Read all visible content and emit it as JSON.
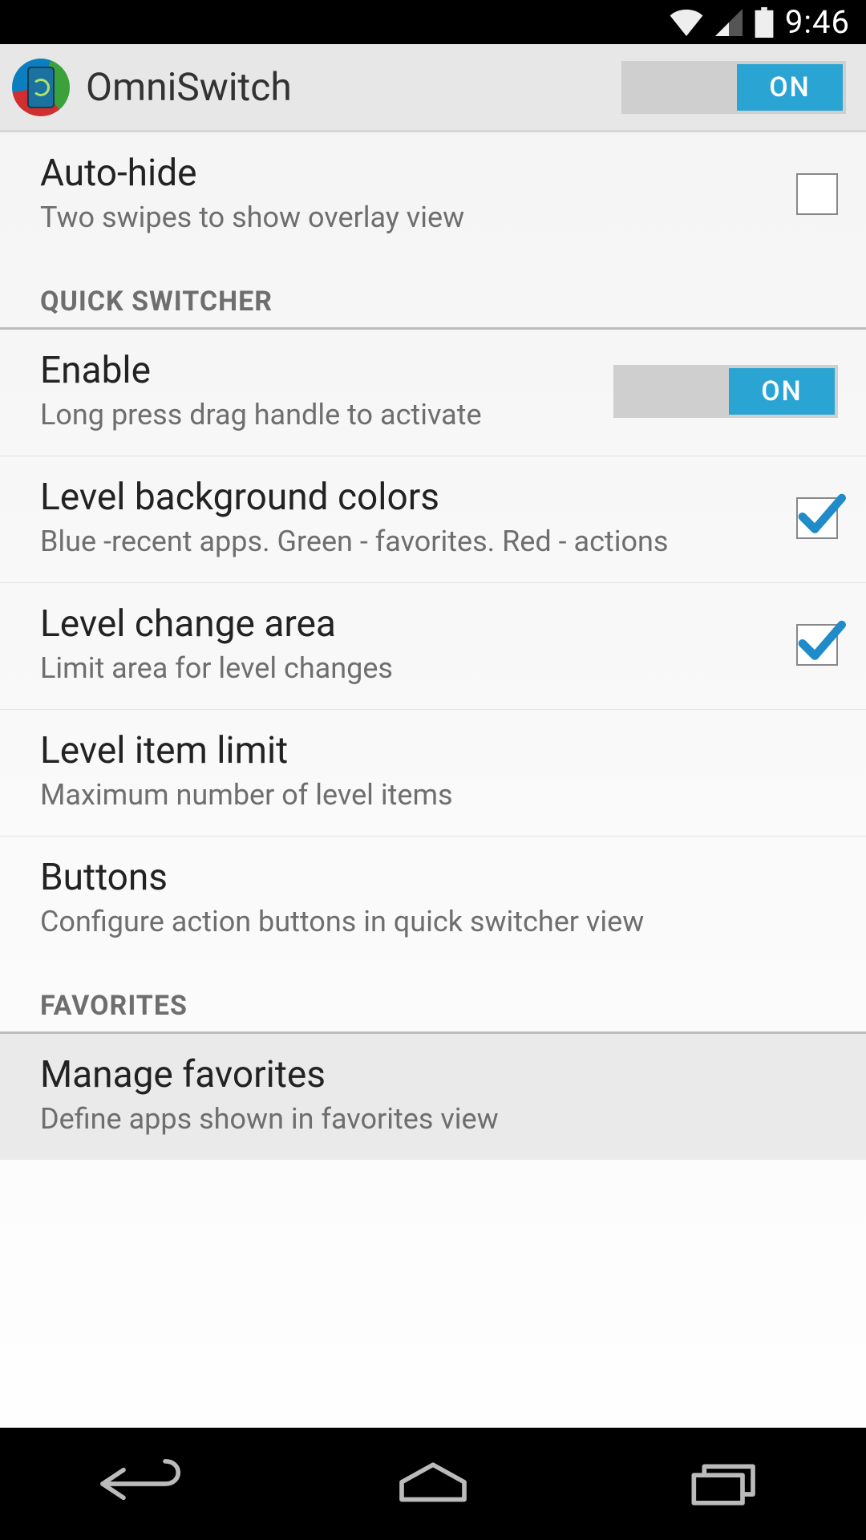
{
  "status": {
    "time": "9:46"
  },
  "header": {
    "title": "OmniSwitch",
    "master_switch": "ON"
  },
  "settings": [
    {
      "kind": "checkbox",
      "title": "Auto-hide",
      "sub": "Two swipes to show overlay view",
      "checked": false
    },
    {
      "kind": "section",
      "label": "QUICK SWITCHER"
    },
    {
      "kind": "switch",
      "title": "Enable",
      "sub": "Long press drag handle to activate",
      "state": "ON"
    },
    {
      "kind": "checkbox",
      "title": "Level background colors",
      "sub": "Blue -recent apps. Green - favorites. Red - actions",
      "checked": true
    },
    {
      "kind": "checkbox",
      "title": "Level change area",
      "sub": "Limit area for level changes",
      "checked": true
    },
    {
      "kind": "plain",
      "title": "Level item limit",
      "sub": "Maximum number of level items"
    },
    {
      "kind": "plain",
      "title": "Buttons",
      "sub": "Configure action buttons in quick switcher view"
    },
    {
      "kind": "section",
      "label": "FAVORITES"
    },
    {
      "kind": "plain",
      "title": "Manage favorites",
      "sub": "Define apps shown in favorites view",
      "pressed": true
    }
  ]
}
